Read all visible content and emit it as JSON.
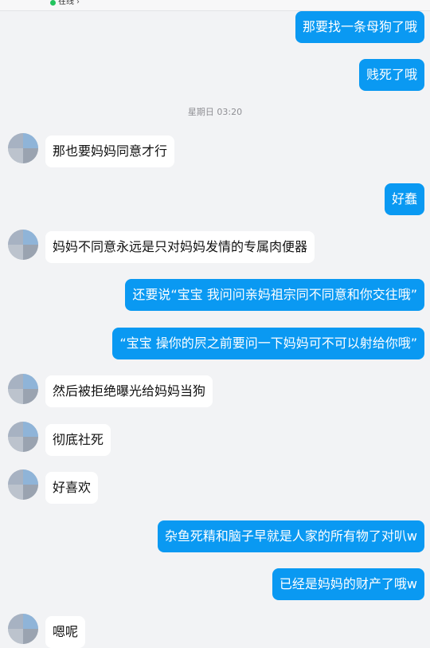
{
  "header": {
    "status": "在线"
  },
  "timestamp": "星期日 03:20",
  "messages": [
    {
      "text": "那要找一条母狗了哦"
    },
    {
      "text": "贱死了哦"
    },
    {
      "text": "那也要妈妈同意才行"
    },
    {
      "text": "好蠢"
    },
    {
      "text": "妈妈不同意永远是只对妈妈发情的专属肉便器"
    },
    {
      "text": "还要说“宝宝 我问问亲妈祖宗同不同意和你交往哦”"
    },
    {
      "text": "“宝宝 操你的屄之前要问一下妈妈可不可以射给你哦”"
    },
    {
      "text": "然后被拒绝曝光给妈妈当狗"
    },
    {
      "text": "彻底社死"
    },
    {
      "text": "好喜欢"
    },
    {
      "text": "杂鱼死精和脑子早就是人家的所有物了对叭w"
    },
    {
      "text": "已经是妈妈的财产了哦w"
    },
    {
      "text": "嗯呢"
    }
  ]
}
